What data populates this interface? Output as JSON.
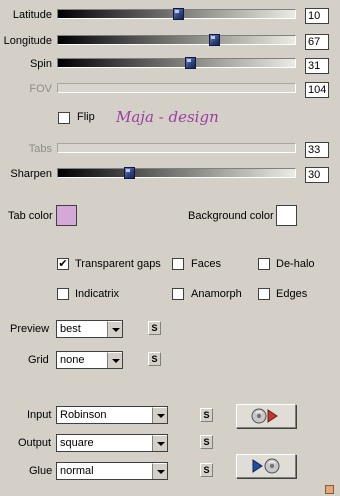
{
  "sliders": {
    "latitude": {
      "label": "Latitude",
      "value": "10",
      "level": 0.51
    },
    "longitude": {
      "label": "Longitude",
      "value": "67",
      "level": 0.67
    },
    "spin": {
      "label": "Spin",
      "value": "31",
      "level": 0.56
    },
    "fov": {
      "label": "FOV",
      "value": "104"
    },
    "tabs": {
      "label": "Tabs",
      "value": "33"
    },
    "sharpen": {
      "label": "Sharpen",
      "value": "30",
      "level": 0.29
    }
  },
  "flip": {
    "label": "Flip",
    "checked": false
  },
  "watermark": "Maja - design",
  "colors": {
    "tab_label": "Tab color",
    "tab_color": "#d4a8d8",
    "background_label": "Background color",
    "background_color": "#ffffff"
  },
  "options": {
    "transparent_gaps": {
      "label": "Transparent gaps",
      "checked": true
    },
    "faces": {
      "label": "Faces",
      "checked": false
    },
    "de_halo": {
      "label": "De-halo",
      "checked": false
    },
    "indicatrix": {
      "label": "Indicatrix",
      "checked": false
    },
    "anamorph": {
      "label": "Anamorph",
      "checked": false
    },
    "edges": {
      "label": "Edges",
      "checked": false
    }
  },
  "preview": {
    "label": "Preview",
    "value": "best",
    "s": "S"
  },
  "grid": {
    "label": "Grid",
    "value": "none",
    "s": "S"
  },
  "input": {
    "label": "Input",
    "value": "Robinson",
    "s": "S"
  },
  "output": {
    "label": "Output",
    "value": "square",
    "s": "S"
  },
  "glue": {
    "label": "Glue",
    "value": "normal",
    "s": "S"
  },
  "check_mark": "✔"
}
